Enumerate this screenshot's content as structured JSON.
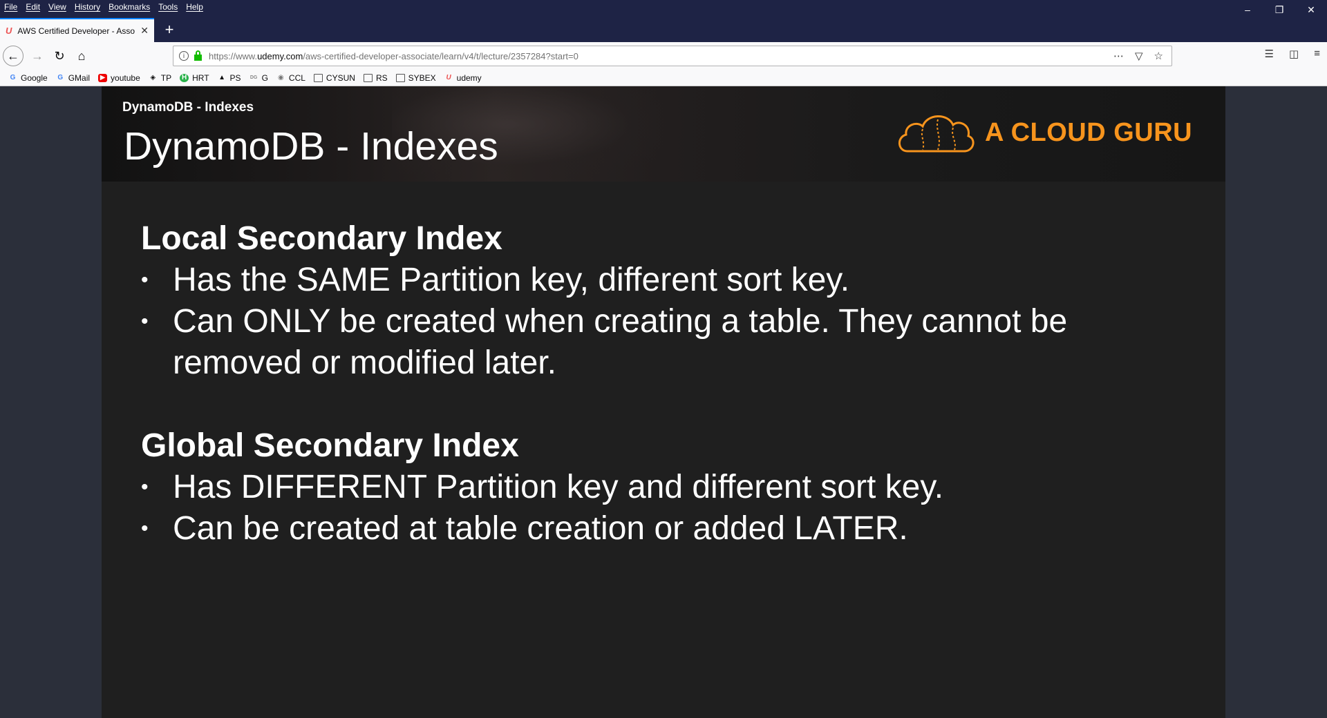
{
  "menubar": {
    "items": [
      "File",
      "Edit",
      "View",
      "History",
      "Bookmarks",
      "Tools",
      "Help"
    ]
  },
  "tab": {
    "title": "AWS Certified Developer - Asso",
    "new_tab_label": "+"
  },
  "urlbar": {
    "url_prefix": "https://www.",
    "url_domain": "udemy.com",
    "url_path": "/aws-certified-developer-associate/learn/v4/t/lecture/2357284?start=0"
  },
  "bookmarks": [
    {
      "label": "Google",
      "icon": "google-icon"
    },
    {
      "label": "GMail",
      "icon": "google-icon"
    },
    {
      "label": "youtube",
      "icon": "youtube-icon"
    },
    {
      "label": "TP",
      "icon": "tp-icon"
    },
    {
      "label": "HRT",
      "icon": "hrt-icon"
    },
    {
      "label": "PS",
      "icon": "ps-icon"
    },
    {
      "label": "G",
      "icon": "g-icon"
    },
    {
      "label": "CCL",
      "icon": "ccl-icon"
    },
    {
      "label": "CYSUN",
      "icon": "folder-icon"
    },
    {
      "label": "RS",
      "icon": "folder-icon"
    },
    {
      "label": "SYBEX",
      "icon": "folder-icon"
    },
    {
      "label": "udemy",
      "icon": "udemy-icon"
    }
  ],
  "slide": {
    "lecture_title": "DynamoDB - Indexes",
    "title": "DynamoDB - Indexes",
    "brand": "A CLOUD GURU",
    "sections": [
      {
        "heading": "Local Secondary Index",
        "bullets": [
          "Has the SAME Partition key, different sort key.",
          "Can ONLY be created when creating a table. They cannot be removed or modified later."
        ]
      },
      {
        "heading": "Global Secondary Index",
        "bullets": [
          "Has DIFFERENT Partition key and different sort key.",
          "Can be created at table creation or added LATER."
        ]
      }
    ]
  },
  "colors": {
    "brand_orange": "#f7941d",
    "titlebar": "#1e2345",
    "slide_bg": "#1f1f1f"
  }
}
